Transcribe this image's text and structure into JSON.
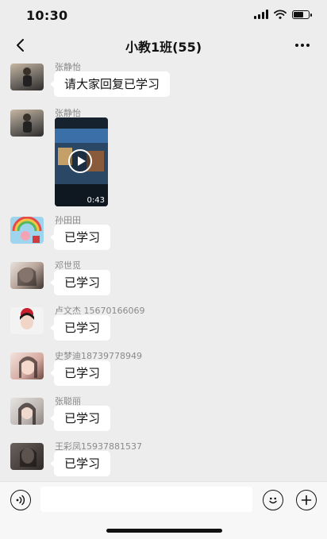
{
  "status_bar": {
    "time": "10:30"
  },
  "nav": {
    "title": "小教1班(55)"
  },
  "messages": [
    {
      "sender": "张静怡",
      "text": "请大家回复已学习"
    },
    {
      "sender": "张静怡",
      "video_duration": "0:43"
    },
    {
      "sender": "孙田田",
      "text": "已学习"
    },
    {
      "sender": "邓世觅",
      "text": "已学习"
    },
    {
      "sender": "卢文杰 15670166069",
      "text": "已学习"
    },
    {
      "sender": "史梦迪18739778949",
      "text": "已学习"
    },
    {
      "sender": "张聪丽",
      "text": "已学习"
    },
    {
      "sender": "王彩凤15937881537",
      "text": "已学习"
    }
  ],
  "input": {
    "placeholder": ""
  },
  "icons": {
    "back": "chevron-left-icon",
    "more": "more-icon",
    "voice": "voice-icon",
    "emoji": "emoji-icon",
    "add": "plus-icon"
  }
}
